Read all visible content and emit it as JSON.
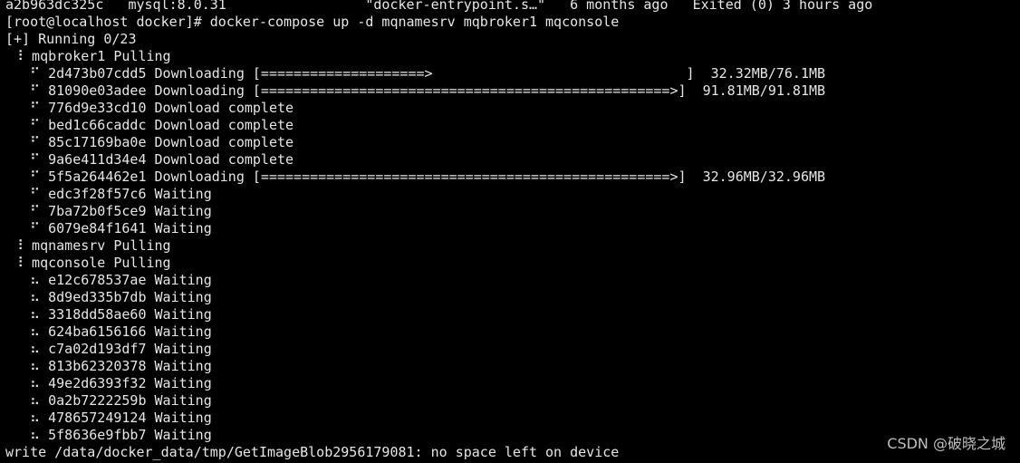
{
  "colors": {
    "background": "#000000",
    "foreground": "#e6e6e6",
    "watermark": "#bfbfbf"
  },
  "terminal": {
    "lines": [
      {
        "name": "container-row",
        "text": "a2b963dc325c   mysql:8.0.31                 \"docker-entrypoint.s…\"   6 months ago   Exited (0) 3 hours ago"
      },
      {
        "name": "command-line",
        "text": "[root@localhost docker]# docker-compose up -d mqnamesrv mqbroker1 mqconsole"
      },
      {
        "name": "running-status",
        "text": "[+] Running 0/23"
      },
      {
        "name": "service-mqbroker1",
        "text": " ⠸ mqbroker1 Pulling"
      },
      {
        "name": "layer-row",
        "text": "   ⠋ 2d473b07cdd5 Downloading [====================>                               ]  32.32MB/76.1MB"
      },
      {
        "name": "layer-row",
        "text": "   ⠋ 81090e03adee Downloading [==================================================>]  91.81MB/91.81MB"
      },
      {
        "name": "layer-row",
        "text": "   ⠋ 776d9e33cd10 Download complete"
      },
      {
        "name": "layer-row",
        "text": "   ⠋ bed1c66caddc Download complete"
      },
      {
        "name": "layer-row",
        "text": "   ⠋ 85c17169ba0e Download complete"
      },
      {
        "name": "layer-row",
        "text": "   ⠋ 9a6e411d34e4 Download complete"
      },
      {
        "name": "layer-row",
        "text": "   ⠋ 5f5a264462e1 Downloading [==================================================>]  32.96MB/32.96MB"
      },
      {
        "name": "layer-row",
        "text": "   ⠋ edc3f28f57c6 Waiting"
      },
      {
        "name": "layer-row",
        "text": "   ⠋ 7ba72b0f5ce9 Waiting"
      },
      {
        "name": "layer-row",
        "text": "   ⠋ 6079e84f1641 Waiting"
      },
      {
        "name": "service-mqnamesrv",
        "text": " ⠸ mqnamesrv Pulling"
      },
      {
        "name": "service-mqconsole",
        "text": " ⠸ mqconsole Pulling"
      },
      {
        "name": "layer-row",
        "text": "   ⠦ e12c678537ae Waiting"
      },
      {
        "name": "layer-row",
        "text": "   ⠦ 8d9ed335b7db Waiting"
      },
      {
        "name": "layer-row",
        "text": "   ⠦ 3318dd58ae60 Waiting"
      },
      {
        "name": "layer-row",
        "text": "   ⠦ 624ba6156166 Waiting"
      },
      {
        "name": "layer-row",
        "text": "   ⠦ c7a02d193df7 Waiting"
      },
      {
        "name": "layer-row",
        "text": "   ⠦ 813b62320378 Waiting"
      },
      {
        "name": "layer-row",
        "text": "   ⠦ 49e2d6393f32 Waiting"
      },
      {
        "name": "layer-row",
        "text": "   ⠦ 0a2b7222259b Waiting"
      },
      {
        "name": "layer-row",
        "text": "   ⠦ 478657249124 Waiting"
      },
      {
        "name": "layer-row",
        "text": "   ⠦ 5f8636e9fbb7 Waiting"
      },
      {
        "name": "error-message",
        "text": "write /data/docker_data/tmp/GetImageBlob2956179081: no space left on device"
      }
    ]
  },
  "watermark": {
    "text": "CSDN @破晓之城"
  }
}
